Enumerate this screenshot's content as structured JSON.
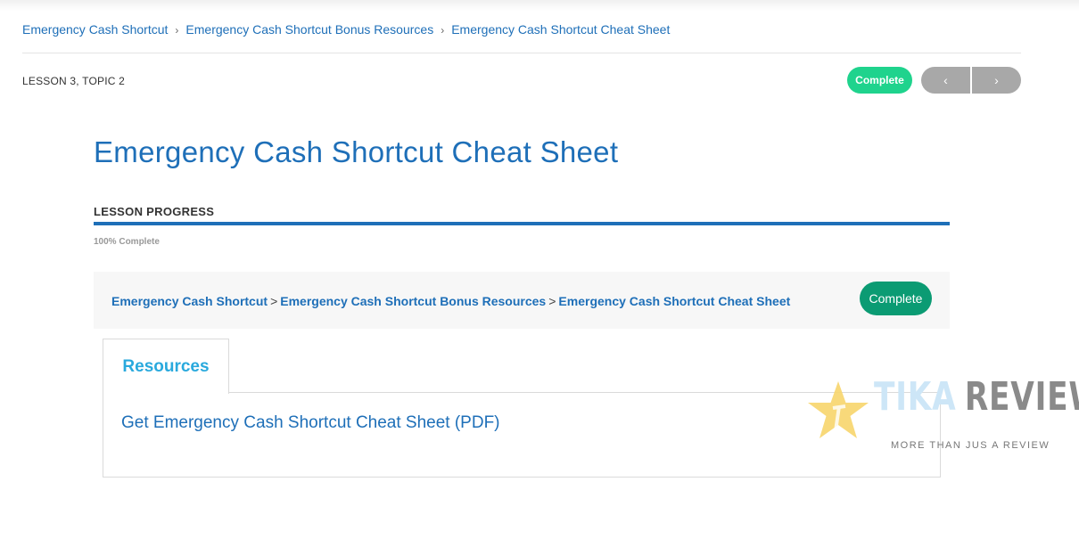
{
  "breadcrumb": {
    "items": [
      "Emergency Cash Shortcut",
      "Emergency Cash Shortcut Bonus Resources",
      "Emergency Cash Shortcut Cheat Sheet"
    ],
    "separator": "›"
  },
  "header": {
    "lesson_label": "LESSON 3, TOPIC 2",
    "complete_label": "Complete",
    "prev_label": "‹",
    "next_label": "›"
  },
  "page": {
    "title": "Emergency Cash Shortcut Cheat Sheet"
  },
  "progress": {
    "heading": "LESSON PROGRESS",
    "percent": 100,
    "text": "100% Complete"
  },
  "trail": {
    "items": [
      "Emergency Cash Shortcut",
      "Emergency Cash Shortcut Bonus Resources",
      "Emergency Cash Shortcut Cheat Sheet"
    ],
    "separator": ">",
    "complete_label": "Complete"
  },
  "tabs": {
    "active_label": "Resources",
    "resource_link": "Get Emergency Cash Shortcut Cheat Sheet (PDF)"
  },
  "watermark": {
    "brand_a": "TIKA",
    "brand_b": "REVIEW",
    "tagline": "MORE THAN JUS A REVIEW"
  },
  "colors": {
    "link_blue": "#1e6fb8",
    "complete_green": "#1fd38d",
    "complete_dark": "#0b9b73",
    "tab_blue": "#29a9dd",
    "nav_gray": "#a8a8a8",
    "star_yellow": "#f7d56b"
  },
  "icons": {
    "prev": "chevron-left-icon",
    "next": "chevron-right-icon",
    "watermark": "star-icon"
  }
}
